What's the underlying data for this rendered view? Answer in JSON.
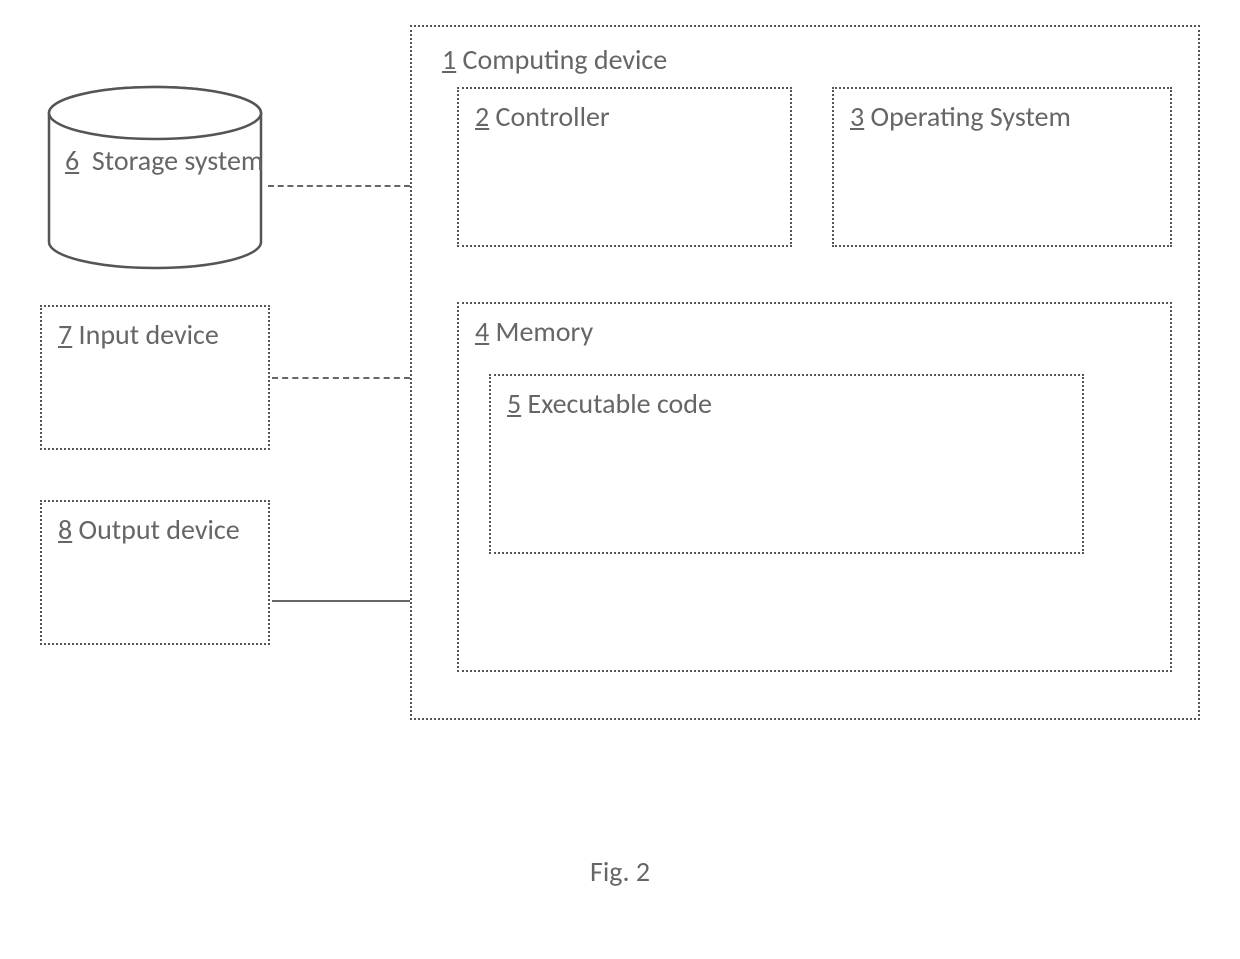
{
  "caption": "Fig. 2",
  "blocks": {
    "storage": {
      "num": "6",
      "label": "Storage system"
    },
    "input": {
      "num": "7",
      "label": "Input device"
    },
    "output": {
      "num": "8",
      "label": "Output device"
    },
    "device": {
      "num": "1",
      "label": "Computing device"
    },
    "controller": {
      "num": "2",
      "label": "Controller"
    },
    "os": {
      "num": "3",
      "label": "Operating System"
    },
    "memory": {
      "num": "4",
      "label": "Memory"
    },
    "code": {
      "num": "5",
      "label": "Executable code"
    }
  }
}
